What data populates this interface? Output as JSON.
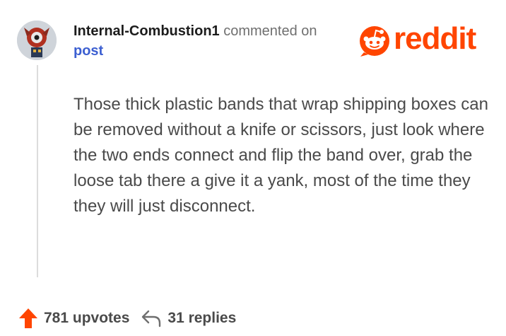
{
  "comment": {
    "username": "Internal-Combustion1",
    "action": "commented on",
    "target": "post",
    "body": "Those thick plastic bands that wrap shipping boxes can be removed without a knife or scissors, just look where the two ends connect and flip the band over, grab the loose tab there a give it a yank, most of the time they they will just disconnect."
  },
  "brand": {
    "name": "reddit",
    "color": "#ff4500"
  },
  "stats": {
    "upvotes": "781 upvotes",
    "replies": "31 replies"
  },
  "icons": {
    "avatar": "avatar-image",
    "upvote": "upvote-arrow-icon",
    "reply": "reply-arrow-icon",
    "logo": "reddit-alien-icon"
  }
}
